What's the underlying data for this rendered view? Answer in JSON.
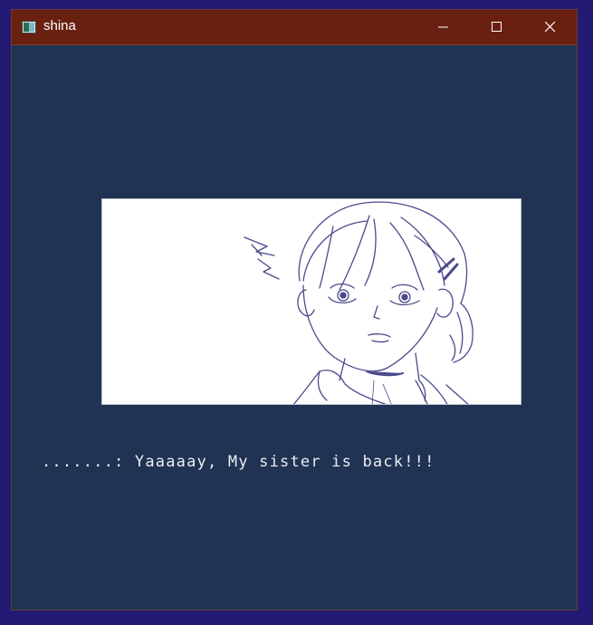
{
  "window": {
    "title": "shina",
    "icon": "app-window-icon",
    "controls": [
      "minimize-icon",
      "maximize-icon",
      "close-icon"
    ]
  },
  "scene": {
    "illustration": "character-portrait",
    "line_color": "#4a4a8c"
  },
  "dialogue": {
    "speaker": ".......",
    "separator": ": ",
    "text": "Yaaaaay, My sister is back!!!"
  },
  "colors": {
    "titlebar": "#6a2011",
    "client_bg": "#213352",
    "outer_bg": "#231a73",
    "text": "#e9edf5"
  }
}
